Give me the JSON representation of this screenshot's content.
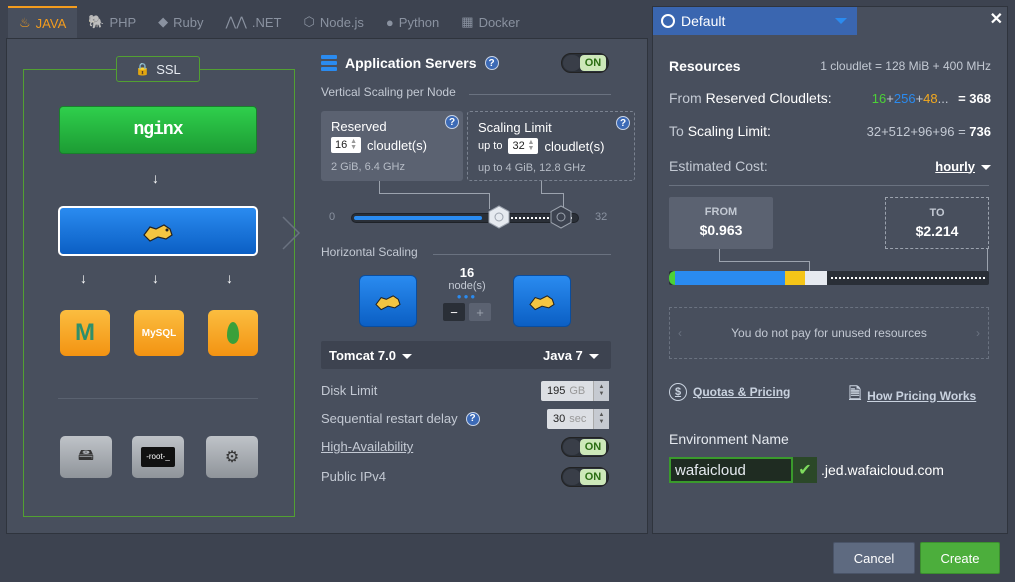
{
  "tabs": [
    {
      "label": "JAVA",
      "icon": "java-icon",
      "active": true
    },
    {
      "label": "PHP",
      "icon": "php-icon"
    },
    {
      "label": "Ruby",
      "icon": "ruby-icon"
    },
    {
      "label": ".NET",
      "icon": "dotnet-icon"
    },
    {
      "label": "Node.js",
      "icon": "nodejs-icon"
    },
    {
      "label": "Python",
      "icon": "python-icon"
    },
    {
      "label": "Docker",
      "icon": "docker-icon"
    }
  ],
  "topology": {
    "ssl_label": "SSL",
    "balancer_label": "nginx",
    "databases": [
      "M",
      "MySQL",
      ""
    ]
  },
  "app_servers": {
    "title": "Application Servers",
    "toggle": "ON",
    "vertical_label": "Vertical Scaling per Node",
    "reserved": {
      "title": "Reserved",
      "value": "16",
      "unit": "cloudlet(s)",
      "desc": "2 GiB, 6.4 GHz"
    },
    "limit": {
      "title": "Scaling Limit",
      "prefix": "up to",
      "value": "32",
      "unit": "cloudlet(s)",
      "desc_prefix": "up to",
      "desc": "4 GiB, 12.8 GHz"
    },
    "slider_min": "0",
    "slider_max": "32",
    "horizontal_label": "Horizontal Scaling",
    "nodes_count": "16",
    "nodes_label": "node(s)",
    "minus": "−",
    "plus": "+",
    "server": "Tomcat 7.0",
    "java_version": "Java 7",
    "disk_limit_label": "Disk Limit",
    "disk_limit_value": "195",
    "disk_limit_unit": "GB",
    "restart_label": "Sequential restart delay",
    "restart_value": "30",
    "restart_unit": "sec",
    "ha_label": "High-Availability",
    "ha_toggle": "ON",
    "ipv4_label": "Public IPv4",
    "ipv4_toggle": "ON"
  },
  "environment": {
    "region": "Default",
    "resources_label": "Resources",
    "cloudlet_def": "1 cloudlet = 128 MiB + 400 MHz",
    "from_label": "From",
    "reserved_cloudlets_label": "Reserved Cloudlets:",
    "reserved_parts": [
      "16",
      "+",
      "256",
      "+",
      "48",
      "..."
    ],
    "reserved_total": "= 368",
    "to_label": "To",
    "scaling_limit_label": "Scaling Limit:",
    "scaling_parts": "32+512+96+96 =",
    "scaling_total": "736",
    "estimated_cost_label": "Estimated Cost:",
    "period": "hourly",
    "from_title": "FROM",
    "from_value": "$0.963",
    "to_title": "TO",
    "to_value": "$2.214",
    "unused_note": "You do not pay for unused resources",
    "quotas_link": "Quotas & Pricing",
    "pricing_link": "How Pricing Works",
    "name_label": "Environment Name",
    "name_value": "wafaicloud",
    "domain_suffix": ".jed.wafaicloud.com"
  },
  "actions": {
    "cancel": "Cancel",
    "create": "Create"
  },
  "colors": {
    "accent": "#f39c1e",
    "primary": "#2a8bf0",
    "success": "#4cae3c"
  }
}
